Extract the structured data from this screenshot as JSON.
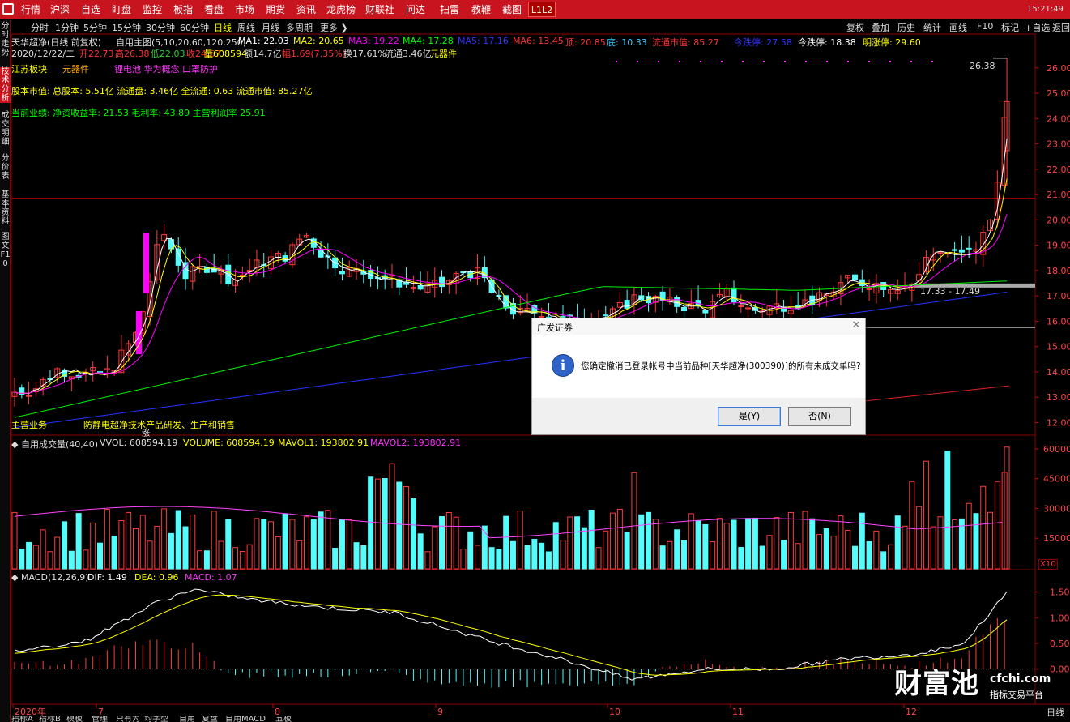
{
  "menu": [
    "行情",
    "沪深",
    "自选",
    "盯盘",
    "监控",
    "板指",
    "看盘",
    "市场",
    "期货",
    "资讯",
    "龙虎榜",
    "财联社",
    "问达",
    "扫雷",
    "教鞭",
    "截图"
  ],
  "l1l2": "L1L2",
  "clock": "15:21:49",
  "left_tabs": [
    "分时走势",
    "技术分析",
    "成交明细",
    "分价表",
    "基本资料",
    "图文F10"
  ],
  "periods": [
    "分时",
    "1分钟",
    "5分钟",
    "15分钟",
    "30分钟",
    "60分钟",
    "日线",
    "周线",
    "月线",
    "多周期",
    "更多"
  ],
  "active_period": "日线",
  "right_buttons": [
    "复权",
    "叠加",
    "历史",
    "统计",
    "画线",
    "F10",
    "标记",
    "+自选",
    "返回"
  ],
  "main_chart": {
    "title": "天华超净(日线 前复权)",
    "formula": "自用主图(5,10,20,60,120,250)",
    "ma": [
      {
        "label": "MA1: 22.03",
        "color": "#ffffff"
      },
      {
        "label": "MA2: 20.65",
        "color": "#ffff00"
      },
      {
        "label": "MA3: 19.22",
        "color": "#ff00ff"
      },
      {
        "label": "MA4: 17.28",
        "color": "#00ff00"
      },
      {
        "label": "MA5: 17.16",
        "color": "#3333ff"
      },
      {
        "label": "MA6: 13.45",
        "color": "#ff3333"
      }
    ],
    "top": "顶: 20.85",
    "bottom": "底: 10.33",
    "float_mv": "流通市值: 85.27",
    "today_limit_down": "今跌停: 27.58",
    "today_limit_down2": "今跌停: 18.38",
    "tomorrow_limit_up": "明涨停: 29.60",
    "quote": {
      "date": "2020/12/22/二",
      "open": "开22.73",
      "high": "高26.38",
      "low": "低22.03",
      "close": "收24.67",
      "volume": "量608594",
      "amount": "额14.7亿",
      "change": "幅1.69(7.35%)",
      "turnover": "换17.61%",
      "float_shares": "流通3.46亿",
      "concept": "元器件"
    },
    "sector_line": {
      "region": "江苏板块",
      "industry": "元器件",
      "concepts": "锂电池 华为概念 口罩防护"
    },
    "equity_line": "股本市值: 总股本: 5.51亿 流通盘: 3.46亿 全流通: 0.63 流通市值: 85.27亿",
    "perf_line": "当前业绩: 净资收益率: 21.53 毛利率: 43.89 主营利润率 25.91",
    "main_business_label": "主营业务",
    "main_business": "防静电超净技术产品研发、生产和销售",
    "zhang": "涨",
    "high_marker": "26.38",
    "range_label": "17.33 - 17.49",
    "y_ticks": [
      "26.00",
      "25.00",
      "24.00",
      "23.00",
      "22.00",
      "21.00",
      "20.00",
      "19.00",
      "18.00",
      "17.00",
      "16.00",
      "15.00",
      "14.00",
      "13.00",
      "12.00"
    ]
  },
  "volume_chart": {
    "title": "自用成交量(40,40)",
    "vvol": "VVOL: 608594.19",
    "volume": "VOLUME: 608594.19",
    "mavol1": "MAVOL1: 193802.91",
    "mavol2": "MAVOL2: 193802.91",
    "y_ticks": [
      "60000",
      "45000",
      "30000",
      "15000"
    ],
    "unit": "X10"
  },
  "macd_chart": {
    "title": "MACD(12,26,9)",
    "dif": "DIF: 1.49",
    "dea": "DEA: 0.96",
    "macd": "MACD: 1.07",
    "y_ticks": [
      "1.50",
      "1.00",
      "0.50",
      "0.00"
    ]
  },
  "x_axis": [
    "2020年",
    "7",
    "8",
    "9",
    "10",
    "11",
    "12"
  ],
  "x_axis_right": "日线",
  "bottom_tabs": [
    "指标A",
    "指标B",
    "模板",
    "管理",
    "只有为",
    "均字型",
    "自用",
    "复盘",
    "自用MACD",
    "五板"
  ],
  "dialog": {
    "title": "广发证券",
    "message": "您确定撤消已登录帐号中当前品种[天华超净(300390)]的所有未成交单吗?",
    "yes": "是(Y)",
    "no": "否(N)"
  },
  "watermark": {
    "brand": "财富池",
    "domain": "cfchi.com",
    "slogan": "指标交易平台"
  },
  "chart_data": {
    "type": "candlestick",
    "ohlc": [
      {
        "date": "2020/12/22",
        "open": 22.73,
        "high": 26.38,
        "low": 22.03,
        "close": 24.67,
        "volume": 608594
      }
    ],
    "ylim_main": [
      11.6,
      26.6
    ],
    "ylim_volume": [
      0,
      62000
    ],
    "ylim_macd": [
      -0.65,
      1.65
    ]
  }
}
